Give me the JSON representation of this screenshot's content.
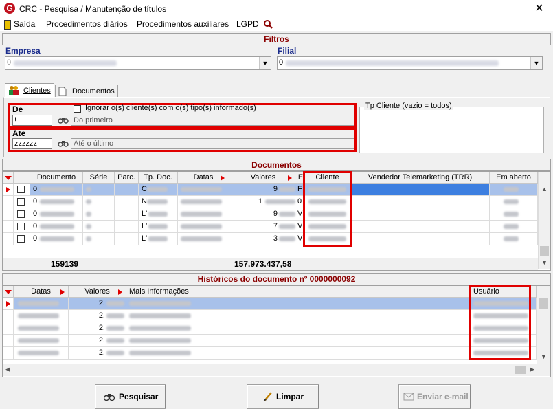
{
  "window": {
    "title": "CRC - Pesquisa / Manutenção de títulos",
    "close": "✕",
    "app_icon": "G"
  },
  "menu": {
    "items": [
      "Saída",
      "Procedimentos diários",
      "Procedimentos auxiliares",
      "LGPD"
    ]
  },
  "filtros": {
    "title": "Filtros",
    "empresa_label": "Empresa",
    "empresa_value": "0",
    "filial_label": "Filial",
    "filial_value": "0",
    "tabs": [
      "Clientes",
      "Documentos"
    ],
    "de_label": "De",
    "de_value": "!",
    "de_desc": "Do primeiro",
    "ate_label": "Ate",
    "ate_value": "zzzzzz",
    "ate_desc": "Até o último",
    "ignore_label": "Ignorar o(s) cliente(s) com o(s) tipo(s) informado(s)",
    "tp_cliente_label": "Tp Cliente (vazio = todos)"
  },
  "documentos": {
    "title": "Documentos",
    "columns": [
      "Documento",
      "Série",
      "Parc.",
      "Tp. Doc.",
      "Datas",
      "Valores",
      "E",
      "Cliente",
      "Vendedor Telemarketing (TRR)",
      "Em aberto"
    ],
    "rows": [
      {
        "doc": "0",
        "tp": "C",
        "valor": "9",
        "e": "F"
      },
      {
        "doc": "0",
        "tp": "N",
        "valor": "1",
        "e": "0"
      },
      {
        "doc": "0",
        "tp": "L'",
        "valor": "9",
        "e": "V"
      },
      {
        "doc": "0",
        "tp": "L'",
        "valor": "7",
        "e": "V"
      },
      {
        "doc": "0",
        "tp": "L'",
        "valor": "3",
        "e": "V"
      }
    ],
    "total_count": "159139",
    "total_value": "157.973.437,58"
  },
  "historicos": {
    "title": "Históricos do documento nº 0000000092",
    "columns": [
      "Datas",
      "Valores",
      "Mais Informações",
      "Usuário"
    ],
    "rows": [
      {
        "valor": "2."
      },
      {
        "valor": "2."
      },
      {
        "valor": "2."
      },
      {
        "valor": "2."
      },
      {
        "valor": "2."
      }
    ]
  },
  "buttons": {
    "pesquisar": "Pesquisar",
    "limpar": "Limpar",
    "enviar": "Enviar e-mail"
  },
  "colors": {
    "accent_red": "#e00000",
    "section_title": "#8b0000",
    "label_blue": "#1a2c8c",
    "selected_row": "#a8c1ea"
  }
}
